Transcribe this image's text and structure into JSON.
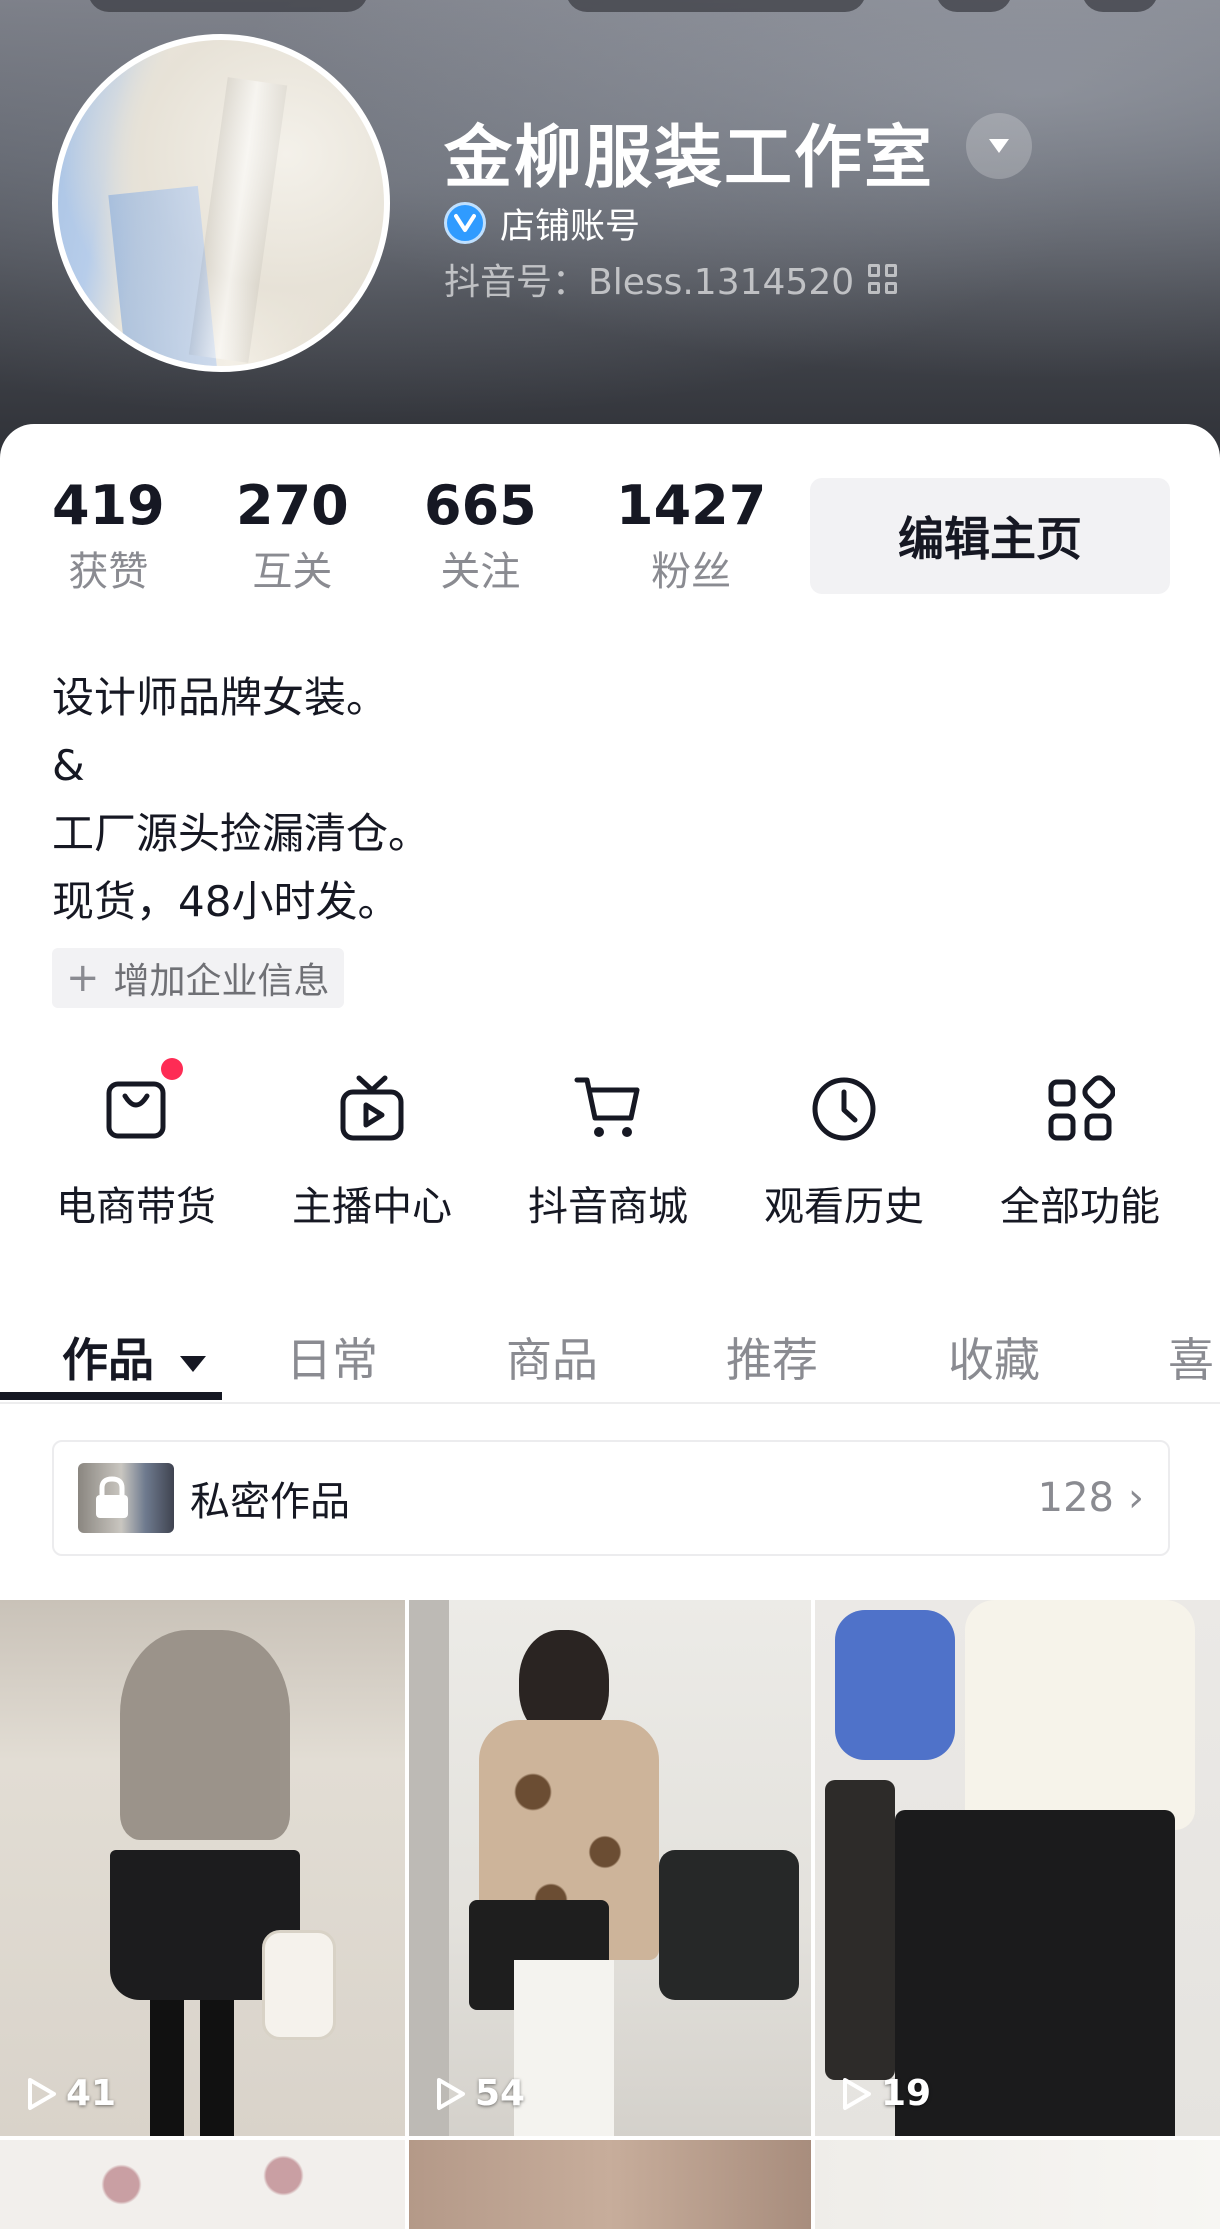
{
  "profile": {
    "name": "金柳服装工作室",
    "verification_label": "店铺账号",
    "douyin_id": "抖音号：Bless.1314520"
  },
  "stats": [
    {
      "value": "419",
      "label": "获赞"
    },
    {
      "value": "270",
      "label": "互关"
    },
    {
      "value": "665",
      "label": "关注"
    },
    {
      "value": "1427",
      "label": "粉丝"
    }
  ],
  "edit_button_label": "编辑主页",
  "bio": {
    "lines": [
      "设计师品牌女装。",
      "&",
      "工厂源头捡漏清仓。",
      "现货，48小时发。"
    ],
    "add_company_label": "增加企业信息"
  },
  "features": [
    {
      "label": "电商带货",
      "icon": "shopping-bag-icon",
      "has_notification": true
    },
    {
      "label": "主播中心",
      "icon": "live-tv-icon",
      "has_notification": false
    },
    {
      "label": "抖音商城",
      "icon": "shopping-cart-icon",
      "has_notification": false
    },
    {
      "label": "观看历史",
      "icon": "clock-icon",
      "has_notification": false
    },
    {
      "label": "全部功能",
      "icon": "apps-grid-icon",
      "has_notification": false
    }
  ],
  "tabs": [
    {
      "label": "作品",
      "active": true
    },
    {
      "label": "日常",
      "active": false
    },
    {
      "label": "商品",
      "active": false
    },
    {
      "label": "推荐",
      "active": false
    },
    {
      "label": "收藏",
      "active": false
    },
    {
      "label": "喜",
      "active": false
    }
  ],
  "private_works": {
    "label": "私密作品",
    "count": "128"
  },
  "videos": [
    {
      "plays": "41"
    },
    {
      "plays": "54"
    },
    {
      "plays": "19"
    }
  ],
  "colors": {
    "accent_red": "#fe2c55",
    "verify_blue": "#2f9bff",
    "text_primary": "#161823",
    "text_secondary": "#8a8b91"
  }
}
